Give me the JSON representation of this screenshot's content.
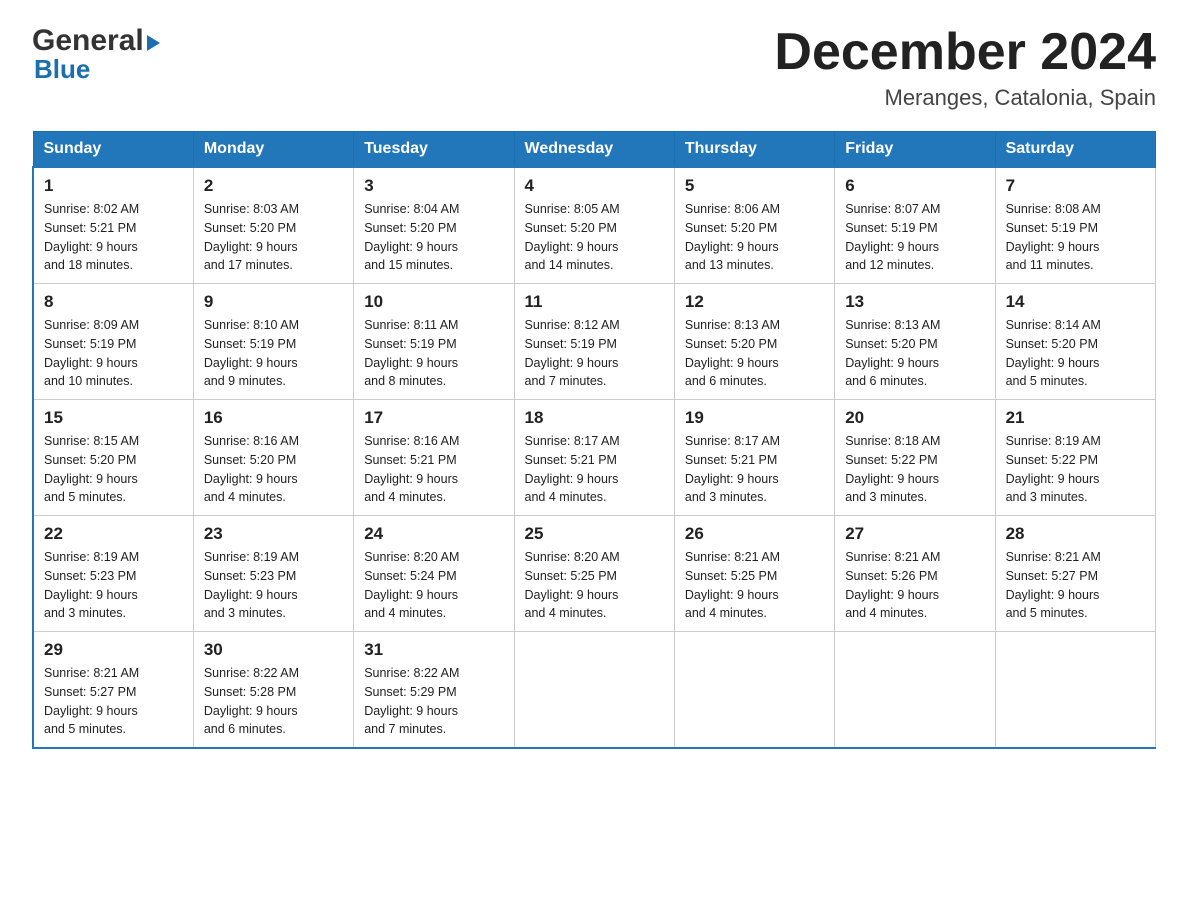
{
  "header": {
    "logo_general": "General",
    "logo_blue": "Blue",
    "title": "December 2024",
    "subtitle": "Meranges, Catalonia, Spain"
  },
  "days_of_week": [
    "Sunday",
    "Monday",
    "Tuesday",
    "Wednesday",
    "Thursday",
    "Friday",
    "Saturday"
  ],
  "weeks": [
    [
      {
        "day": "1",
        "sunrise": "8:02 AM",
        "sunset": "5:21 PM",
        "daylight": "9 hours and 18 minutes."
      },
      {
        "day": "2",
        "sunrise": "8:03 AM",
        "sunset": "5:20 PM",
        "daylight": "9 hours and 17 minutes."
      },
      {
        "day": "3",
        "sunrise": "8:04 AM",
        "sunset": "5:20 PM",
        "daylight": "9 hours and 15 minutes."
      },
      {
        "day": "4",
        "sunrise": "8:05 AM",
        "sunset": "5:20 PM",
        "daylight": "9 hours and 14 minutes."
      },
      {
        "day": "5",
        "sunrise": "8:06 AM",
        "sunset": "5:20 PM",
        "daylight": "9 hours and 13 minutes."
      },
      {
        "day": "6",
        "sunrise": "8:07 AM",
        "sunset": "5:19 PM",
        "daylight": "9 hours and 12 minutes."
      },
      {
        "day": "7",
        "sunrise": "8:08 AM",
        "sunset": "5:19 PM",
        "daylight": "9 hours and 11 minutes."
      }
    ],
    [
      {
        "day": "8",
        "sunrise": "8:09 AM",
        "sunset": "5:19 PM",
        "daylight": "9 hours and 10 minutes."
      },
      {
        "day": "9",
        "sunrise": "8:10 AM",
        "sunset": "5:19 PM",
        "daylight": "9 hours and 9 minutes."
      },
      {
        "day": "10",
        "sunrise": "8:11 AM",
        "sunset": "5:19 PM",
        "daylight": "9 hours and 8 minutes."
      },
      {
        "day": "11",
        "sunrise": "8:12 AM",
        "sunset": "5:19 PM",
        "daylight": "9 hours and 7 minutes."
      },
      {
        "day": "12",
        "sunrise": "8:13 AM",
        "sunset": "5:20 PM",
        "daylight": "9 hours and 6 minutes."
      },
      {
        "day": "13",
        "sunrise": "8:13 AM",
        "sunset": "5:20 PM",
        "daylight": "9 hours and 6 minutes."
      },
      {
        "day": "14",
        "sunrise": "8:14 AM",
        "sunset": "5:20 PM",
        "daylight": "9 hours and 5 minutes."
      }
    ],
    [
      {
        "day": "15",
        "sunrise": "8:15 AM",
        "sunset": "5:20 PM",
        "daylight": "9 hours and 5 minutes."
      },
      {
        "day": "16",
        "sunrise": "8:16 AM",
        "sunset": "5:20 PM",
        "daylight": "9 hours and 4 minutes."
      },
      {
        "day": "17",
        "sunrise": "8:16 AM",
        "sunset": "5:21 PM",
        "daylight": "9 hours and 4 minutes."
      },
      {
        "day": "18",
        "sunrise": "8:17 AM",
        "sunset": "5:21 PM",
        "daylight": "9 hours and 4 minutes."
      },
      {
        "day": "19",
        "sunrise": "8:17 AM",
        "sunset": "5:21 PM",
        "daylight": "9 hours and 3 minutes."
      },
      {
        "day": "20",
        "sunrise": "8:18 AM",
        "sunset": "5:22 PM",
        "daylight": "9 hours and 3 minutes."
      },
      {
        "day": "21",
        "sunrise": "8:19 AM",
        "sunset": "5:22 PM",
        "daylight": "9 hours and 3 minutes."
      }
    ],
    [
      {
        "day": "22",
        "sunrise": "8:19 AM",
        "sunset": "5:23 PM",
        "daylight": "9 hours and 3 minutes."
      },
      {
        "day": "23",
        "sunrise": "8:19 AM",
        "sunset": "5:23 PM",
        "daylight": "9 hours and 3 minutes."
      },
      {
        "day": "24",
        "sunrise": "8:20 AM",
        "sunset": "5:24 PM",
        "daylight": "9 hours and 4 minutes."
      },
      {
        "day": "25",
        "sunrise": "8:20 AM",
        "sunset": "5:25 PM",
        "daylight": "9 hours and 4 minutes."
      },
      {
        "day": "26",
        "sunrise": "8:21 AM",
        "sunset": "5:25 PM",
        "daylight": "9 hours and 4 minutes."
      },
      {
        "day": "27",
        "sunrise": "8:21 AM",
        "sunset": "5:26 PM",
        "daylight": "9 hours and 4 minutes."
      },
      {
        "day": "28",
        "sunrise": "8:21 AM",
        "sunset": "5:27 PM",
        "daylight": "9 hours and 5 minutes."
      }
    ],
    [
      {
        "day": "29",
        "sunrise": "8:21 AM",
        "sunset": "5:27 PM",
        "daylight": "9 hours and 5 minutes."
      },
      {
        "day": "30",
        "sunrise": "8:22 AM",
        "sunset": "5:28 PM",
        "daylight": "9 hours and 6 minutes."
      },
      {
        "day": "31",
        "sunrise": "8:22 AM",
        "sunset": "5:29 PM",
        "daylight": "9 hours and 7 minutes."
      },
      null,
      null,
      null,
      null
    ]
  ],
  "labels": {
    "sunrise": "Sunrise:",
    "sunset": "Sunset:",
    "daylight": "Daylight:"
  }
}
